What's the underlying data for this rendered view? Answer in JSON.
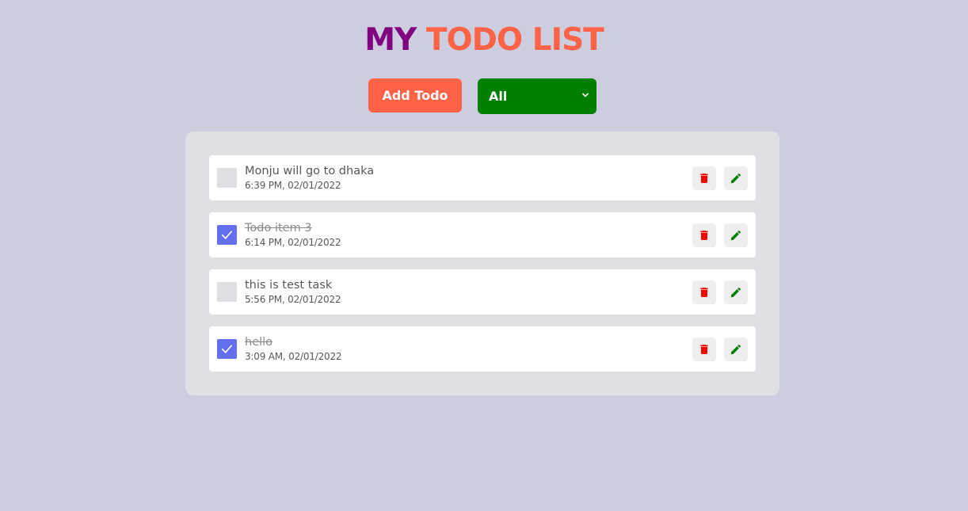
{
  "header": {
    "title_part1": "MY",
    "title_part2": "TODO LIST"
  },
  "toolbar": {
    "add_label": "Add Todo",
    "filter_selected": "All"
  },
  "todos": [
    {
      "title": "Monju will go to dhaka",
      "time": "6:39 PM, 02/01/2022",
      "completed": false
    },
    {
      "title": "Todo item 3",
      "time": "6:14 PM, 02/01/2022",
      "completed": true
    },
    {
      "title": "this is test task",
      "time": "5:56 PM, 02/01/2022",
      "completed": false
    },
    {
      "title": "hello",
      "time": "3:09 AM, 02/01/2022",
      "completed": true
    }
  ],
  "icons": {
    "delete": "trash-icon",
    "edit": "pencil-icon",
    "check": "check-icon",
    "select": "chevron-down-icon"
  },
  "colors": {
    "background": "#cdcde0",
    "title_primary": "#800080",
    "title_accent": "#ff6347",
    "add_button": "#ff6347",
    "filter_select": "#008000",
    "checkbox_checked": "#646ff0",
    "delete_icon": "#ff0000",
    "edit_icon": "#008000"
  }
}
